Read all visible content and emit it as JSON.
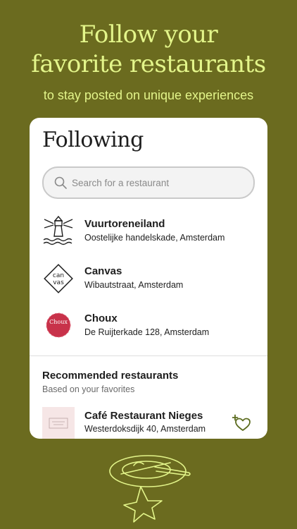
{
  "hero": {
    "title_line1": "Follow your",
    "title_line2": "favorite restaurants",
    "subtitle": "to stay posted on unique experiences"
  },
  "card": {
    "title": "Following",
    "search": {
      "placeholder": "Search for a restaurant",
      "value": ""
    },
    "following": [
      {
        "name": "Vuurtoreneiland",
        "address": "Oostelijke handelskade, Amsterdam",
        "logo": "lighthouse-logo"
      },
      {
        "name": "Canvas",
        "address": "Wibautstraat, Amsterdam",
        "logo": "canvas-logo",
        "logo_text_top": "can",
        "logo_text_bottom": "vas"
      },
      {
        "name": "Choux",
        "address": "De Ruijterkade 128, Amsterdam",
        "logo": "choux-logo",
        "logo_text": "Choux"
      }
    ],
    "recommended": {
      "title": "Recommended restaurants",
      "subtitle": "Based on your favorites",
      "items": [
        {
          "name": "Café Restaurant Nieges",
          "address": "Westerdoksdijk 40, Amsterdam",
          "action_icon": "heart-plus-icon"
        }
      ]
    }
  },
  "colors": {
    "background": "#6b6b1f",
    "accent": "#e3f58a",
    "card": "#ffffff",
    "choux": "#c8324a",
    "heart_icon": "#5b6b1e"
  }
}
